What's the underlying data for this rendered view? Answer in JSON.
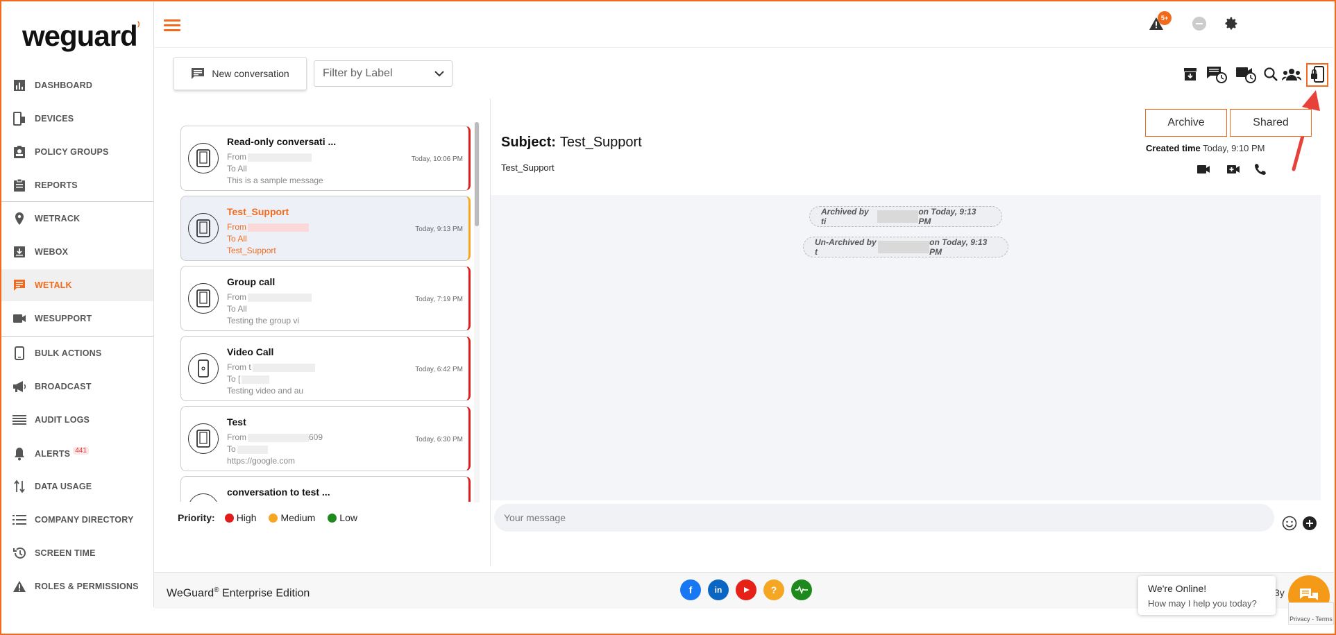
{
  "app": {
    "logo_text": "weguard"
  },
  "sidebar": {
    "items": [
      {
        "label": "DASHBOARD"
      },
      {
        "label": "DEVICES"
      },
      {
        "label": "POLICY GROUPS"
      },
      {
        "label": "REPORTS"
      },
      {
        "label": "WETRACK"
      },
      {
        "label": "WEBOX"
      },
      {
        "label": "WETALK"
      },
      {
        "label": "WESUPPORT"
      },
      {
        "label": "BULK ACTIONS"
      },
      {
        "label": "BROADCAST"
      },
      {
        "label": "AUDIT LOGS"
      },
      {
        "label": "ALERTS",
        "badge": "441"
      },
      {
        "label": "DATA USAGE"
      },
      {
        "label": "COMPANY DIRECTORY"
      },
      {
        "label": "SCREEN TIME"
      },
      {
        "label": "ROLES & PERMISSIONS"
      }
    ]
  },
  "topbar": {
    "notification_badge": "5+"
  },
  "toolbar": {
    "new_conversation_label": "New conversation",
    "filter_placeholder": "Filter by Label"
  },
  "conversations": [
    {
      "title": "Read-only conversati ...",
      "from": "From",
      "to": "To All",
      "preview": "This is a sample message",
      "time": "Today, 10:06 PM"
    },
    {
      "title": "Test_Support",
      "from": "From",
      "to": "To All",
      "preview": "Test_Support",
      "time": "Today, 9:13 PM"
    },
    {
      "title": "Group call",
      "from": "From",
      "to": "To All",
      "preview": "Testing the group vi",
      "time": "Today, 7:19 PM"
    },
    {
      "title": "Video Call",
      "from": "From t",
      "to": "To [",
      "preview": "Testing video and au",
      "time": "Today, 6:42 PM"
    },
    {
      "title": "Test",
      "from": "From",
      "from_suffix": "609",
      "to": "To",
      "preview": "https://google.com",
      "time": "Today, 6:30 PM"
    },
    {
      "title": "conversation to test ..."
    }
  ],
  "priority": {
    "label": "Priority:",
    "levels": [
      {
        "name": "High",
        "color": "#e21b1b"
      },
      {
        "name": "Medium",
        "color": "#f5a623"
      },
      {
        "name": "Low",
        "color": "#1e8a1e"
      }
    ]
  },
  "detail": {
    "subject_label": "Subject:",
    "subject": "Test_Support",
    "subtitle": "Test_Support",
    "archive_label": "Archive",
    "shared_label": "Shared",
    "created_label": "Created time",
    "created_value": "Today, 9:10 PM",
    "system_messages": [
      {
        "prefix": "Archived by ti",
        "suffix": "on Today, 9:13 PM"
      },
      {
        "prefix": "Un-Archived by t",
        "suffix": "on Today, 9:13 PM"
      }
    ],
    "message_placeholder": "Your message"
  },
  "footer": {
    "brand": "WeGuard",
    "reg": "®",
    "edition": " Enterprise Edition",
    "right_text": "3y"
  },
  "chat_widget": {
    "title": "We're Online!",
    "subtitle": "How may I help you today?",
    "recaptcha": "Privacy - Terms"
  },
  "colors": {
    "accent": "#f26a1b",
    "high": "#e21b1b",
    "medium": "#f5a623",
    "low": "#1e8a1e"
  }
}
